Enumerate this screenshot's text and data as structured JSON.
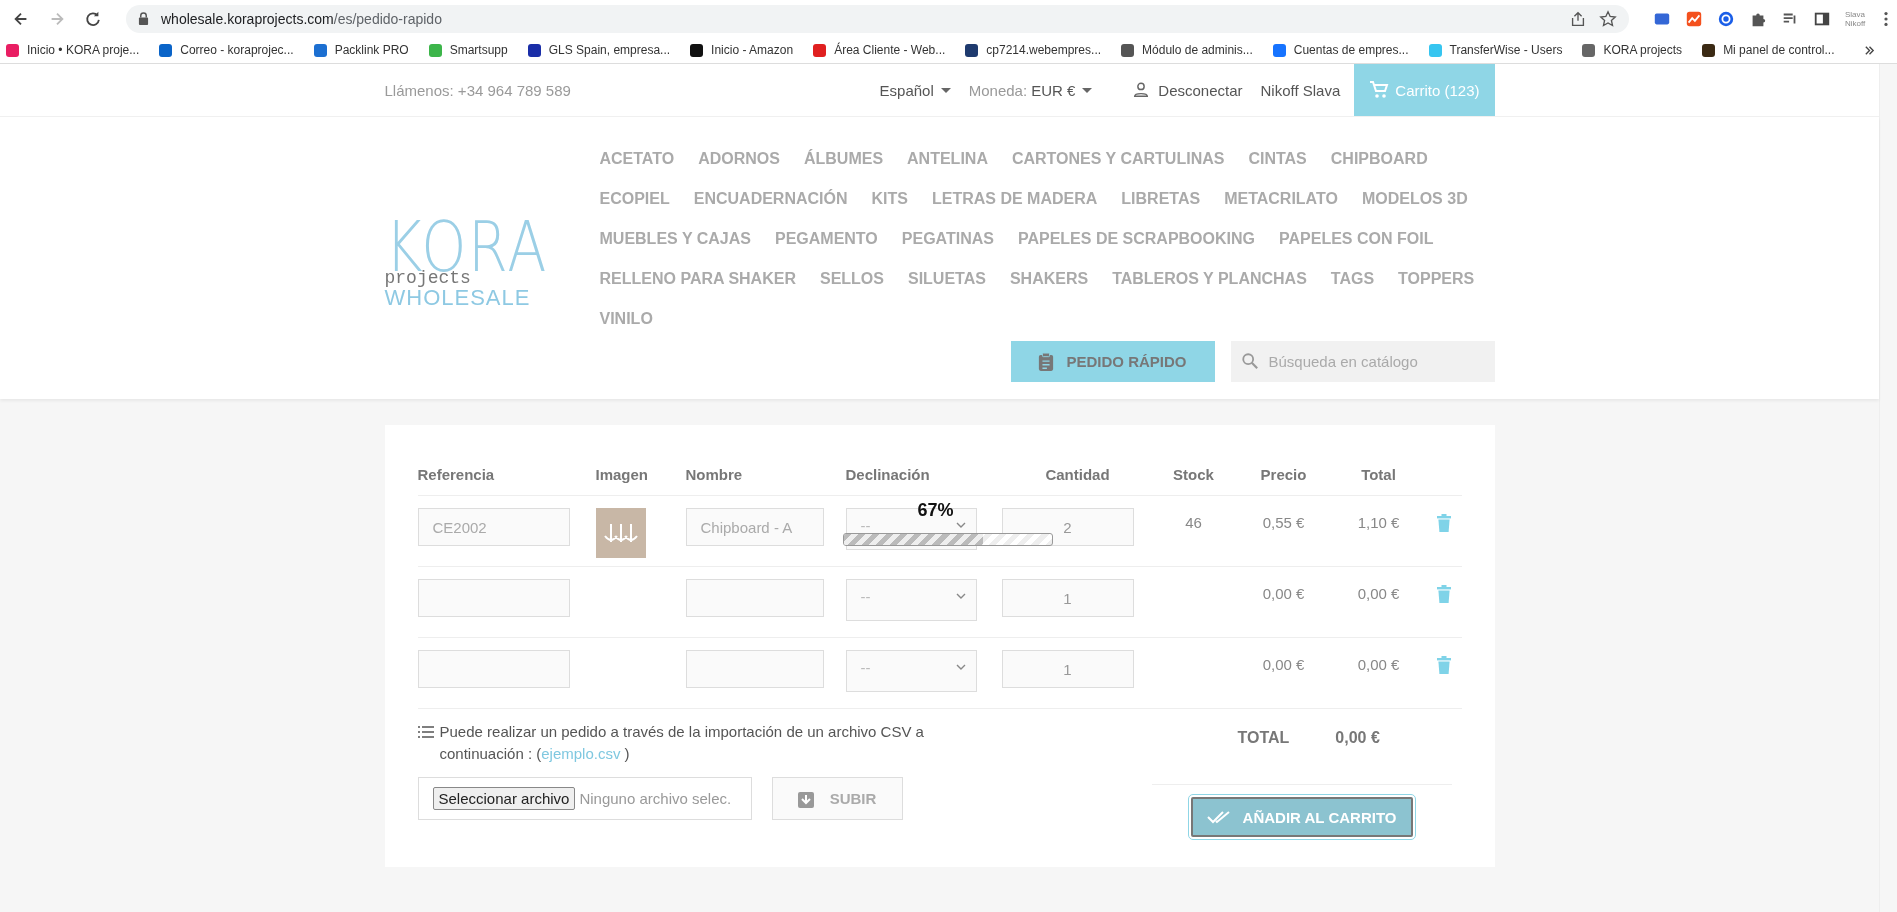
{
  "browser": {
    "url_host": "wholesale.koraprojects.com",
    "url_path": "/es/pedido-rapido",
    "profile": "Slava Nikoff",
    "bookmarks": [
      {
        "label": "Inicio • KORA proje...",
        "color": "#e91e63"
      },
      {
        "label": "Correo - koraprojec...",
        "color": "#0a64c8"
      },
      {
        "label": "Packlink PRO",
        "color": "#1c6fd1"
      },
      {
        "label": "Smartsupp",
        "color": "#3cb54a"
      },
      {
        "label": "GLS Spain, empresa...",
        "color": "#1a2ea8"
      },
      {
        "label": "Inicio - Amazon",
        "color": "#111111"
      },
      {
        "label": "Área Cliente - Web...",
        "color": "#e02020"
      },
      {
        "label": "cp7214.webempres...",
        "color": "#1e3a6e"
      },
      {
        "label": "Módulo de adminis...",
        "color": "#555555"
      },
      {
        "label": "Cuentas de empres...",
        "color": "#1673ff"
      },
      {
        "label": "TransferWise - Users",
        "color": "#36c5f0"
      },
      {
        "label": "KORA projects",
        "color": "#666666"
      },
      {
        "label": "Mi panel de control...",
        "color": "#3b2a14"
      }
    ]
  },
  "topbar": {
    "phone_label": "Llámenos:",
    "phone": "+34 964 789 589",
    "language": "Español",
    "currency_label": "Moneda:",
    "currency": "EUR €",
    "logout": "Desconectar",
    "user": "Nikoff Slava",
    "cart": "Carrito (123)"
  },
  "logo": {
    "main": "KORA",
    "sub": "projects",
    "line": "WHOLESALE"
  },
  "menu": [
    "ACETATO",
    "ADORNOS",
    "ÁLBUMES",
    "ANTELINA",
    "CARTONES Y CARTULINAS",
    "CINTAS",
    "CHIPBOARD",
    "ECOPIEL",
    "ENCUADERNACIÓN",
    "KITS",
    "LETRAS DE MADERA",
    "LIBRETAS",
    "METACRILATO",
    "MODELOS 3D",
    "MUEBLES Y CAJAS",
    "PEGAMENTO",
    "PEGATINAS",
    "PAPELES DE SCRAPBOOKING",
    "PAPELES CON FOIL",
    "RELLENO PARA SHAKER",
    "SELLOS",
    "SILUETAS",
    "SHAKERS",
    "TABLEROS Y PLANCHAS",
    "TAGS",
    "TOPPERS",
    "VINILO"
  ],
  "quick_order_button": "PEDIDO RÁPIDO",
  "search": {
    "placeholder": "Búsqueda en catálogo"
  },
  "table": {
    "columns": [
      "Referencia",
      "Imagen",
      "Nombre",
      "Declinación",
      "Cantidad",
      "Stock",
      "Precio",
      "Total"
    ],
    "rows": [
      {
        "reference": "CE2002",
        "has_image": true,
        "name": "Chipboard - A",
        "declination": "--",
        "quantity": "2",
        "stock": "46",
        "price": "0,55 €",
        "total": "1,10 €"
      },
      {
        "reference": "",
        "has_image": false,
        "name": "",
        "declination": "--",
        "quantity": "1",
        "price": "0,00 €",
        "total": "0,00 €"
      },
      {
        "reference": "",
        "has_image": false,
        "name": "",
        "declination": "--",
        "quantity": "1",
        "price": "0,00 €",
        "total": "0,00 €"
      }
    ]
  },
  "progress": {
    "reading": "67%",
    "level": 0.67
  },
  "import": {
    "note": "Puede realizar un pedido a través de la importación de un archivo CSV a continuación :  (",
    "link": "ejemplo.csv",
    "note_end": ")",
    "file_button": "Seleccionar archivo",
    "file_status": "Ninguno archivo selec.",
    "upload_button": "SUBIR"
  },
  "summary": {
    "total_label": "TOTAL",
    "total_value": "0,00 €",
    "add_button": "AÑADIR AL CARRITO"
  }
}
